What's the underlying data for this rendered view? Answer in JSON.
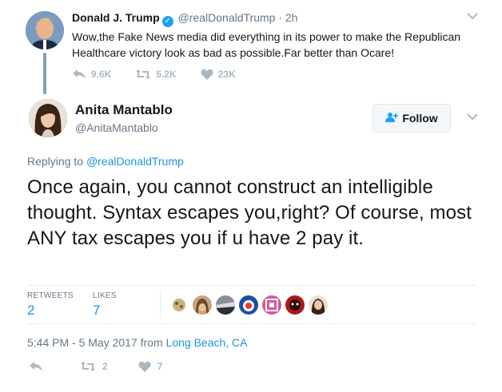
{
  "parent_tweet": {
    "name": "Donald J. Trump",
    "handle": "@realDonaldTrump",
    "dot": "·",
    "time": "2h",
    "text": "Wow,the Fake News media did everything in its power to make the Republican Healthcare victory look as bad as possible.Far better than Ocare!",
    "replies": "9.6K",
    "retweets": "5.2K",
    "likes": "23K",
    "verified_icon": "verified-badge-icon"
  },
  "tweet": {
    "author_name": "Anita Mantablo",
    "author_handle": "@AnitaMantablo",
    "follow_label": "Follow",
    "replying_prefix": "Replying to",
    "replying_to": "@realDonaldTrump",
    "text": "Once again, you cannot construct an intelligible thought. Syntax escapes you,right? Of course, most ANY tax escapes you if u have 2 pay it.",
    "retweets_label": "RETWEETS",
    "retweets_count": "2",
    "likes_label": "LIKES",
    "likes_count": "7",
    "timestamp": "5:44 PM - 5 May 2017 from",
    "location": "Long Beach, CA",
    "action_retweets": "2",
    "action_likes": "7"
  },
  "colors": {
    "link": "#1b95e0",
    "verified": "#1da1f2",
    "muted": "#657786",
    "icon": "#aab8c2"
  }
}
